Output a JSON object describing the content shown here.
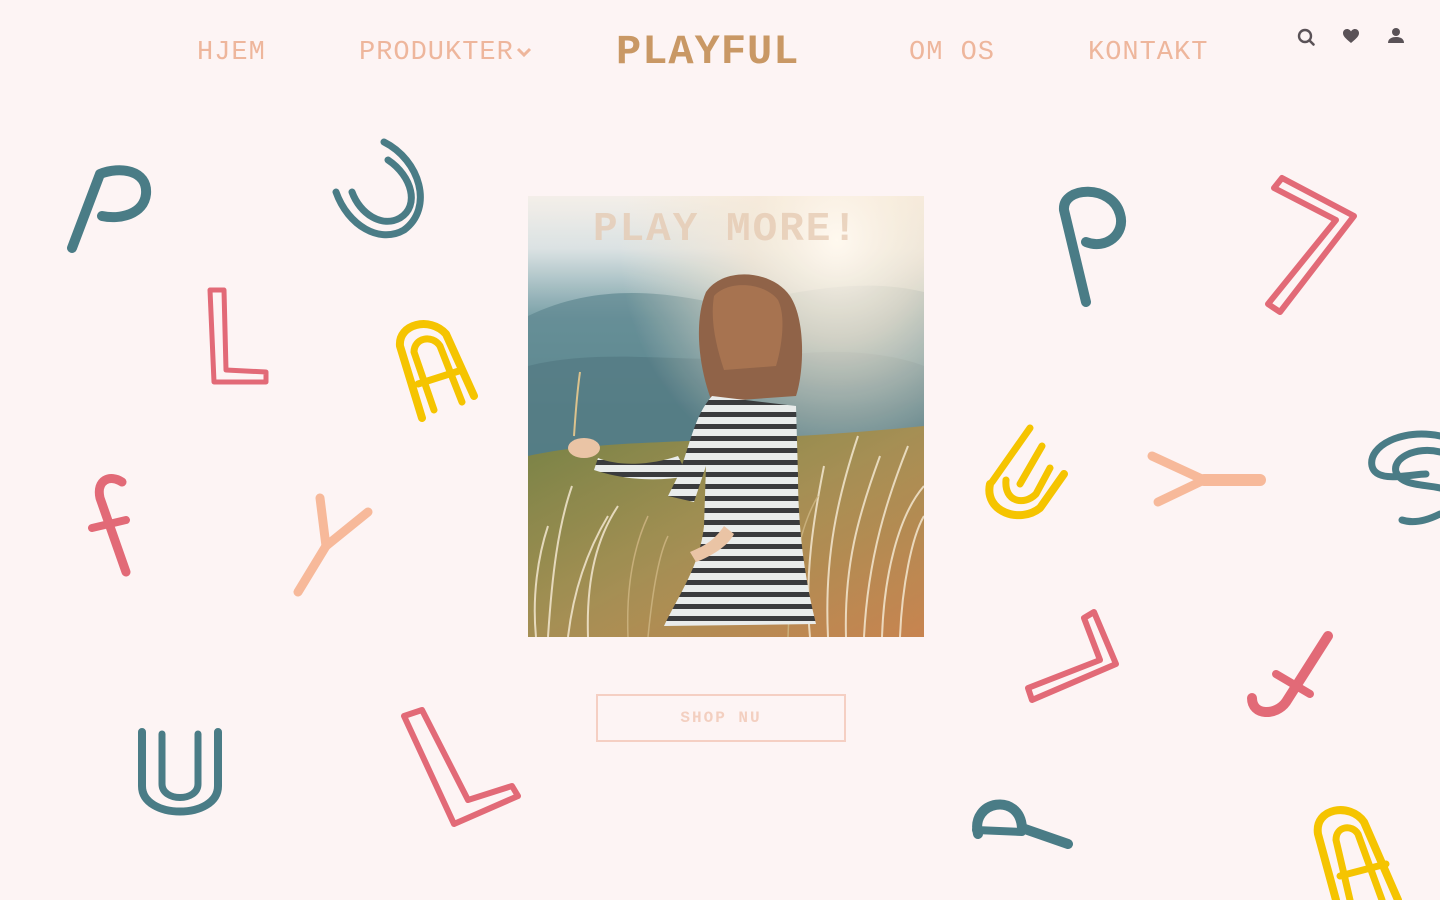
{
  "nav": {
    "home": "HJEM",
    "products": "PRODUKTER",
    "about": "OM OS",
    "contact": "KONTAKT"
  },
  "brand": "PLAYFUL",
  "icons": [
    "search-icon",
    "heart-icon",
    "user-icon",
    "chevron-down-icon"
  ],
  "hero": {
    "title": "PLAY MORE!",
    "cta": "SHOP NU"
  },
  "colors": {
    "background": "#fdf4f4",
    "nav_text": "#eeb69c",
    "brand": "#c99865",
    "teal": "#4a7c86",
    "pink": "#e26a77",
    "yellow": "#f5c400",
    "peach": "#f7b99a",
    "icon": "#5a5257"
  }
}
